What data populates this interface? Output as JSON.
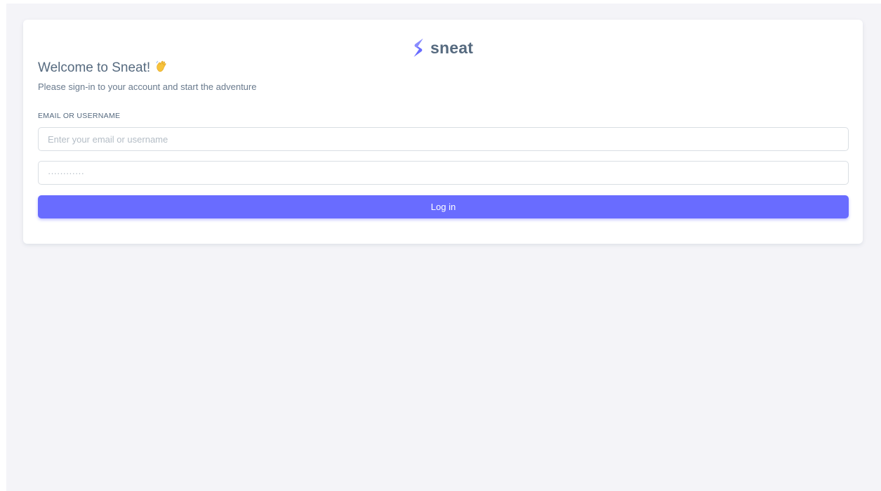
{
  "brand": {
    "name": "sneat",
    "logo_icon": "sneat-logo-icon",
    "logo_color": "#696cff"
  },
  "login": {
    "title": "Welcome to Sneat!",
    "title_icon": "waving-hand-icon",
    "subtitle": "Please sign-in to your account and start the adventure",
    "email_label": "EMAIL OR USERNAME",
    "email_placeholder": "Enter your email or username",
    "email_value": "",
    "password_placeholder": "············",
    "password_value": "",
    "login_button_label": "Log in"
  },
  "colors": {
    "primary": "#696cff",
    "page_background": "#f4f4f8",
    "card_background": "#ffffff",
    "heading_text": "#566a7f",
    "body_text": "#697a8d",
    "input_border": "#d9dee3"
  }
}
